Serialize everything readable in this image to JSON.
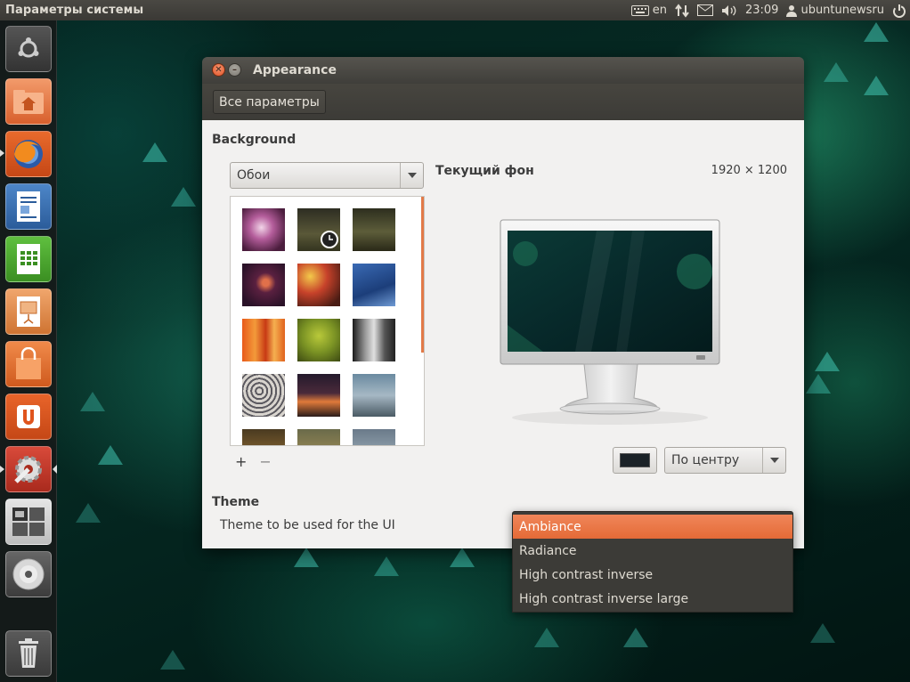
{
  "top_panel": {
    "app_title": "Параметры системы",
    "keyboard_layout": "en",
    "clock": "23:09",
    "user": "ubuntunewsru"
  },
  "launcher": {
    "items": [
      {
        "name": "dash-home",
        "icon": "ubuntu-logo-icon"
      },
      {
        "name": "home-folder",
        "icon": "home-folder-icon"
      },
      {
        "name": "firefox",
        "icon": "firefox-icon"
      },
      {
        "name": "libreoffice-writer",
        "icon": "writer-icon"
      },
      {
        "name": "libreoffice-calc",
        "icon": "calc-icon"
      },
      {
        "name": "libreoffice-impress",
        "icon": "impress-icon"
      },
      {
        "name": "software-center",
        "icon": "shopping-bag-icon"
      },
      {
        "name": "ubuntu-one",
        "icon": "ubuntu-one-icon"
      },
      {
        "name": "system-settings",
        "icon": "settings-icon"
      },
      {
        "name": "workspace-switcher",
        "icon": "workspaces-icon"
      },
      {
        "name": "cd-drive",
        "icon": "cd-icon"
      },
      {
        "name": "trash",
        "icon": "trash-icon"
      }
    ]
  },
  "window": {
    "title": "Appearance",
    "toolbar": {
      "all_settings_label": "Все параметры"
    },
    "background": {
      "section_title": "Background",
      "source_combo": "Обои",
      "current_label": "Текущий фон",
      "resolution": "1920 × 1200",
      "add_label": "+",
      "remove_label": "−",
      "position_combo": "По центру",
      "color": "#1b2227"
    },
    "theme": {
      "section_title": "Theme",
      "description": "Theme to be used for the UI"
    }
  },
  "theme_menu": {
    "options": [
      "Ambiance",
      "Radiance",
      "High contrast inverse",
      "High contrast inverse large"
    ],
    "selected": "Ambiance"
  },
  "colors": {
    "accent": "#e46a37",
    "panel": "#3c3b37"
  }
}
